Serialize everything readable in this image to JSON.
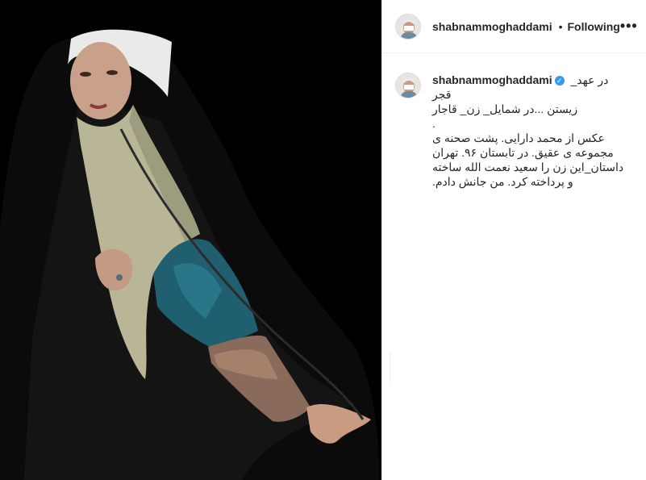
{
  "header": {
    "username": "shabnammoghaddami",
    "separator": "•",
    "follow_status": "Following",
    "more_label": "•••"
  },
  "caption": {
    "username": "shabnammoghaddami",
    "verified_icon": "check-icon",
    "lines": [
      "در عهد_ قجر",
      "زیستن ...در شمایل_ زن_ قاجار",
      ".",
      "عکس از محمد دارایی. پشت صحنه ی",
      "مجموعه ی عقیق. در تابستان ۹۶. تهران",
      "داستان_این زن را سعید نعمت الله ساخته",
      "و پرداخته کرد. من جانش دادم."
    ]
  },
  "colors": {
    "accent": "#3897f0",
    "border": "#efefef",
    "text": "#262626"
  }
}
